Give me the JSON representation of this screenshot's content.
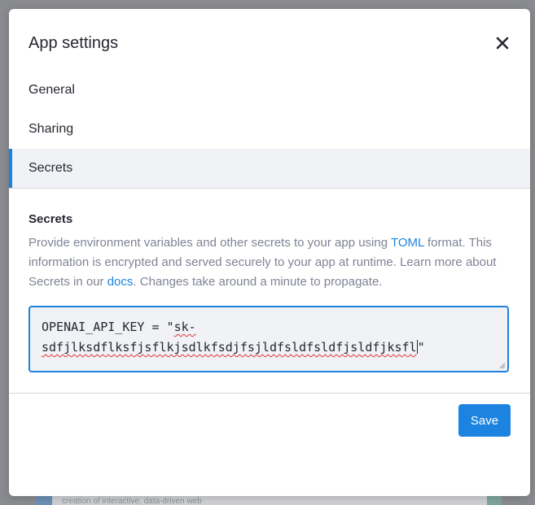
{
  "background": {
    "snippet": "creation of interactive, data-driven web"
  },
  "modal": {
    "title": "App settings",
    "close_icon": "close-icon"
  },
  "nav": {
    "items": [
      {
        "label": "General",
        "active": false
      },
      {
        "label": "Sharing",
        "active": false
      },
      {
        "label": "Secrets",
        "active": true
      }
    ]
  },
  "secrets": {
    "heading": "Secrets",
    "description_part1": "Provide environment variables and other secrets to your app using ",
    "toml_link": "TOML",
    "description_part2": " format. This information is encrypted and served securely to your app at runtime. Learn more about Secrets in our ",
    "docs_link": "docs",
    "description_part3": ". Changes take around a minute to propagate.",
    "editor_line1_prefix": "OPENAI_API_KEY = \"",
    "editor_line1_token": "sk-",
    "editor_line2_token": "sdfjlksdflksfjsflkjsdlkfsdjfsjldfsldfsldfjsldfjksfl",
    "editor_line2_suffix": "\""
  },
  "footer": {
    "save_label": "Save"
  },
  "colors": {
    "accent": "#1c83e1",
    "text": "#262730",
    "muted": "#808495",
    "active_bg": "#f0f2f6",
    "overlay": "#8a8b8f"
  }
}
